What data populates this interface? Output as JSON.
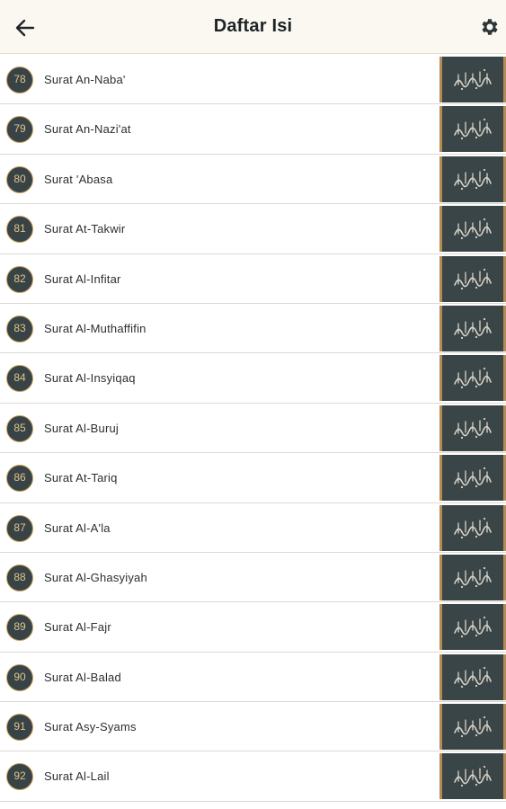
{
  "appbar": {
    "title": "Daftar Isi",
    "back_icon": "arrow-left-icon",
    "settings_icon": "gear-icon"
  },
  "surahs": [
    {
      "number": "78",
      "name": "Surat An-Naba'"
    },
    {
      "number": "79",
      "name": "Surat An-Nazi'at"
    },
    {
      "number": "80",
      "name": "Surat 'Abasa"
    },
    {
      "number": "81",
      "name": "Surat At-Takwir"
    },
    {
      "number": "82",
      "name": "Surat Al-Infitar"
    },
    {
      "number": "83",
      "name": "Surat Al-Muthaffifin"
    },
    {
      "number": "84",
      "name": "Surat Al-Insyiqaq"
    },
    {
      "number": "85",
      "name": "Surat Al-Buruj"
    },
    {
      "number": "86",
      "name": "Surat At-Tariq"
    },
    {
      "number": "87",
      "name": "Surat Al-A'la"
    },
    {
      "number": "88",
      "name": "Surat Al-Ghasyiyah"
    },
    {
      "number": "89",
      "name": "Surat Al-Fajr"
    },
    {
      "number": "90",
      "name": "Surat Al-Balad"
    },
    {
      "number": "91",
      "name": "Surat Asy-Syams"
    },
    {
      "number": "92",
      "name": "Surat Al-Lail"
    }
  ],
  "colors": {
    "appbar_bg": "#fbf8f1",
    "badge_bg": "#374346",
    "badge_ring": "#c9a05a",
    "badge_text": "#e5c487",
    "calligraphy_bg": "#3a4548",
    "calligraphy_frame": "#b48c53"
  }
}
